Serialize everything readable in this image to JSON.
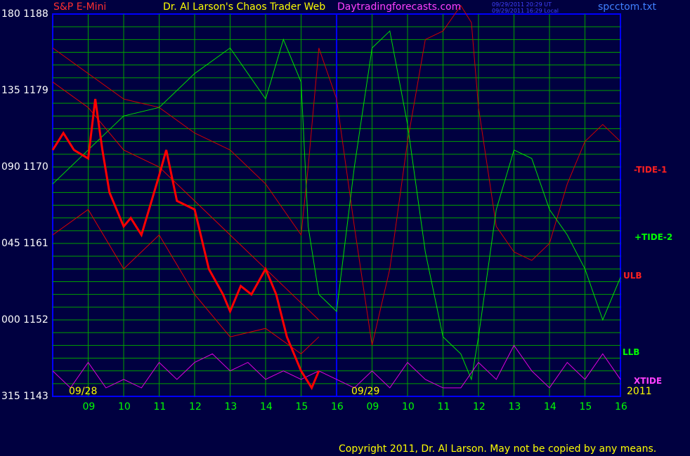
{
  "header": {
    "instrument": "S&P E-Mini",
    "title": "Dr. Al Larson's Chaos Trader Web",
    "site": "Daytradingforecasts.com",
    "time_utc": "09/29/2011 20:29 UT",
    "time_local": "09/29/2011 16:29 Local",
    "file": "spcctom.txt"
  },
  "footer": {
    "copyright": "Copyright 2011, Dr. Al Larson. May not be copied by any means."
  },
  "y_labels": [
    {
      "deg": "180",
      "price": "1188"
    },
    {
      "deg": "135",
      "price": "1179"
    },
    {
      "deg": "090",
      "price": "1170"
    },
    {
      "deg": "045",
      "price": "1161"
    },
    {
      "deg": "000",
      "price": "1152"
    },
    {
      "deg": "315",
      "price": "1143"
    }
  ],
  "x_labels": [
    "09",
    "10",
    "11",
    "12",
    "13",
    "14",
    "15",
    "16",
    "09",
    "10",
    "11",
    "12",
    "13",
    "14",
    "15",
    "16"
  ],
  "date_labels": {
    "day1": "09/28",
    "day2": "09/29",
    "year": "2011"
  },
  "right_labels": {
    "tide1": "-TIDE-1",
    "tide2": "+TIDE-2",
    "ulb": "ULB",
    "llb": "LLB",
    "xtide": "XTIDE"
  },
  "colors": {
    "background": "#000040",
    "grid": "#00a000",
    "axis": "#0000ff",
    "price_down": "#ff0000",
    "price_up": "#ffffff",
    "tide1": "#d00000",
    "tide2": "#00e000",
    "bands": "#e00000",
    "xtide": "#e000e0",
    "ma_fast": "#ffff00",
    "ma_slow": "#00d0ff"
  },
  "chart_data": {
    "type": "line",
    "ylim": [
      1143,
      1188
    ],
    "x_hours": [
      "09",
      "10",
      "11",
      "12",
      "13",
      "14",
      "15",
      "16",
      "09",
      "10",
      "11",
      "12",
      "13",
      "14",
      "15",
      "16"
    ],
    "series": [
      {
        "name": "-TIDE-1",
        "x": [
          0,
          1,
          2,
          3,
          4,
          5,
          6,
          7,
          7.2,
          7.5,
          8,
          8.5,
          9,
          9.5,
          10,
          10.5,
          11,
          11.5,
          11.8,
          12,
          12.5,
          13,
          13.5,
          14,
          14.5,
          15,
          15.5,
          16
        ],
        "y": [
          1184,
          1181,
          1178,
          1177,
          1174,
          1172,
          1168,
          1162,
          1170,
          1184,
          1178,
          1163,
          1149,
          1158,
          1173,
          1185,
          1186,
          1189,
          1187,
          1177,
          1163,
          1160,
          1159,
          1161,
          1168,
          1173,
          1175,
          1173
        ]
      },
      {
        "name": "+TIDE-2",
        "x": [
          0,
          1,
          2,
          3,
          4,
          5,
          5.5,
          6,
          6.5,
          7,
          7.2,
          7.5,
          8,
          8.5,
          9,
          9.5,
          10,
          10.5,
          11,
          11.5,
          11.8,
          12,
          12.5,
          13,
          13.5,
          14,
          14.5,
          15,
          15.5,
          16
        ],
        "y": [
          1168,
          1172,
          1176,
          1177,
          1181,
          1184,
          1181,
          1178,
          1185,
          1180,
          1163,
          1155,
          1153,
          1170,
          1184,
          1186,
          1175,
          1160,
          1150,
          1148,
          1145,
          1150,
          1165,
          1172,
          1171,
          1165,
          1162,
          1158,
          1152,
          1157
        ]
      },
      {
        "name": "ULB",
        "x": [
          0,
          1,
          2,
          3,
          4,
          5,
          6,
          7,
          7.5
        ],
        "y": [
          1180,
          1177,
          1172,
          1170,
          1166,
          1162,
          1158,
          1154,
          1152
        ]
      },
      {
        "name": "LLB",
        "x": [
          0,
          1,
          2,
          3,
          4,
          5,
          6,
          7,
          7.5
        ],
        "y": [
          1162,
          1165,
          1158,
          1162,
          1155,
          1150,
          1151,
          1148,
          1150
        ]
      },
      {
        "name": "XTIDE",
        "x": [
          0,
          0.5,
          1,
          1.5,
          2,
          2.5,
          3,
          3.5,
          4,
          4.5,
          5,
          5.5,
          6,
          6.5,
          7,
          7.5,
          8,
          8.5,
          9,
          9.5,
          10,
          10.5,
          11,
          11.5,
          12,
          12.5,
          13,
          13.5,
          14,
          14.5,
          15,
          15.5,
          16
        ],
        "y": [
          1146,
          1144,
          1147,
          1144,
          1145,
          1144,
          1147,
          1145,
          1147,
          1148,
          1146,
          1147,
          1145,
          1146,
          1145,
          1146,
          1145,
          1144,
          1146,
          1144,
          1147,
          1145,
          1144,
          1144,
          1147,
          1145,
          1149,
          1146,
          1144,
          1147,
          1145,
          1148,
          1145
        ]
      },
      {
        "name": "Price",
        "x": [
          0,
          0.3,
          0.6,
          1,
          1.2,
          1.4,
          1.6,
          2,
          2.2,
          2.5,
          3,
          3.2,
          3.5,
          4,
          4.4,
          4.8,
          5,
          5.3,
          5.6,
          6,
          6.3,
          6.6,
          7,
          7.3,
          7.5
        ],
        "y": [
          1172,
          1174,
          1172,
          1171,
          1178,
          1172,
          1167,
          1163,
          1164,
          1162,
          1169,
          1172,
          1166,
          1165,
          1158,
          1155,
          1153,
          1156,
          1155,
          1158,
          1155,
          1150,
          1146,
          1144,
          1146
        ]
      }
    ]
  }
}
